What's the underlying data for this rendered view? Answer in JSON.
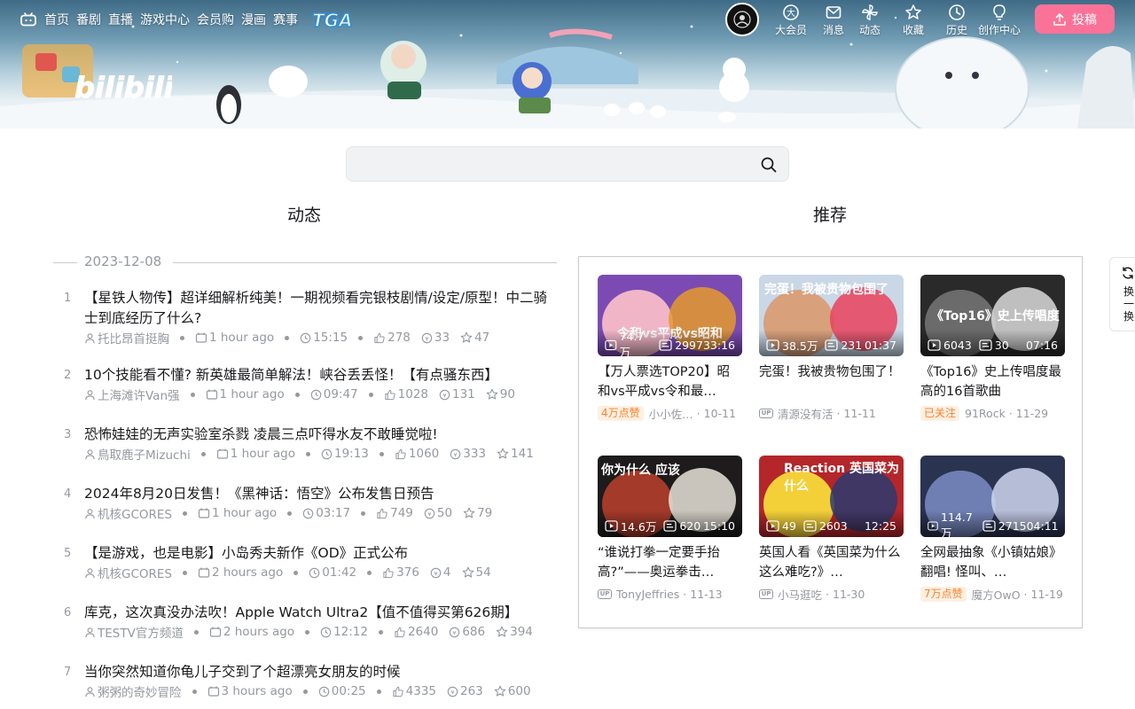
{
  "nav": {
    "left": [
      "首页",
      "番剧",
      "直播",
      "游戏中心",
      "会员购",
      "漫画",
      "赛事"
    ],
    "event_logo": "TGA",
    "right": [
      {
        "label": "大会员",
        "icon": "vip-icon"
      },
      {
        "label": "消息",
        "icon": "message-icon"
      },
      {
        "label": "动态",
        "icon": "dynamic-icon"
      },
      {
        "label": "收藏",
        "icon": "favorite-star-icon"
      },
      {
        "label": "历史",
        "icon": "history-clock-icon"
      },
      {
        "label": "创作中心",
        "icon": "creator-bulb-icon"
      }
    ],
    "upload": "投稿"
  },
  "brand": {
    "logo_text": "bilibili"
  },
  "search": {
    "placeholder": "",
    "value": ""
  },
  "sections": {
    "feed": "动态",
    "recommend": "推荐"
  },
  "feed": {
    "date": "2023-12-08",
    "items": [
      {
        "num": "1",
        "title": "【星铁人物传】超详细解析纯美！一期视频看完银枝剧情/设定/原型！中二骑士到底经历了什么?",
        "author": "托比昂首挺胸",
        "time": "1 hour ago",
        "duration": "15:15",
        "likes": "278",
        "coins": "33",
        "favs": "47"
      },
      {
        "num": "2",
        "title": "10个技能看不懂? 新英雄最简单解法！峡谷丢丢怪！【有点骚东西】",
        "author": "上海滩许Van强",
        "time": "1 hour ago",
        "duration": "09:47",
        "likes": "1028",
        "coins": "131",
        "favs": "90"
      },
      {
        "num": "3",
        "title": "恐怖娃娃的无声实验室杀戮 凌晨三点吓得水友不敢睡觉啦!",
        "author": "鳥取鹿子Mizuchi",
        "time": "1 hour ago",
        "duration": "19:13",
        "likes": "1060",
        "coins": "333",
        "favs": "141"
      },
      {
        "num": "4",
        "title": "2024年8月20日发售！《黑神话：悟空》公布发售日预告",
        "author": "机核GCORES",
        "time": "1 hour ago",
        "duration": "03:17",
        "likes": "749",
        "coins": "50",
        "favs": "79"
      },
      {
        "num": "5",
        "title": "【是游戏，也是电影】小岛秀夫新作《OD》正式公布",
        "author": "机核GCORES",
        "time": "2 hours ago",
        "duration": "01:42",
        "likes": "376",
        "coins": "4",
        "favs": "54"
      },
      {
        "num": "6",
        "title": "库克，这次真没办法吹！Apple Watch Ultra2【值不值得买第626期】",
        "author": "TESTV官方频道",
        "time": "2 hours ago",
        "duration": "12:12",
        "likes": "2640",
        "coins": "686",
        "favs": "394"
      },
      {
        "num": "7",
        "title": "当你突然知道你龟儿子交到了个超漂亮女朋友的时候",
        "author": "粥粥的奇妙冒险",
        "time": "3 hours ago",
        "duration": "00:25",
        "likes": "4335",
        "coins": "263",
        "favs": "600"
      }
    ]
  },
  "recommend": {
    "cards": [
      {
        "title": "【万人票选TOP20】昭和vs平成vs令和最…",
        "views": "74.7万",
        "danmaku": "2997",
        "duration": "33:16",
        "badge": "4万点赞",
        "up_icon": "",
        "author": "小小佐…",
        "date": "10-11",
        "caption": "令和vs平成vs昭和",
        "colors": [
          "#7b4bb3",
          "#f0b6c8",
          "#e59a2d"
        ]
      },
      {
        "title": "完蛋！我被贵物包围了！",
        "views": "38.5万",
        "danmaku": "231",
        "duration": "01:37",
        "badge": "",
        "up_icon": "UP",
        "author": "清源没有活",
        "date": "11-11",
        "caption": "完蛋！我被贵物包围了",
        "colors": [
          "#c9d7e6",
          "#d8a07b",
          "#e9425c"
        ]
      },
      {
        "title": "《Top16》史上传唱度最高的16首歌曲",
        "views": "6043",
        "danmaku": "30",
        "duration": "07:16",
        "badge": "已关注",
        "up_icon": "",
        "author": "91Rock",
        "date": "11-29",
        "caption": "《Top16》史上传唱度",
        "colors": [
          "#2a2a2a",
          "#6b6b6b",
          "#d9d9d9"
        ]
      },
      {
        "title": "“谁说打拳一定要手抬高?”——奥运拳击…",
        "views": "14.6万",
        "danmaku": "620",
        "duration": "15:10",
        "badge": "",
        "up_icon": "UP",
        "author": "TonyJeffries",
        "date": "11-13",
        "caption": "你为什么 应该",
        "colors": [
          "#1d1b1b",
          "#a33a2a",
          "#e8e3d9"
        ]
      },
      {
        "title": "英国人看《英国菜为什么这么难吃?》…",
        "views": "49",
        "danmaku": "2603",
        "duration": "12:25",
        "badge": "",
        "up_icon": "UP",
        "author": "小马逛吃",
        "date": "11-30",
        "caption": "Reaction 英国菜为什么",
        "colors": [
          "#b4262a",
          "#f3d038",
          "#2b3b6e"
        ]
      },
      {
        "title": "全网最抽象《小镇姑娘》翻唱! 怪叫、…",
        "views": "114.7万",
        "danmaku": "2715",
        "duration": "04:11",
        "badge": "7万点赞",
        "up_icon": "",
        "author": "魔方OwO",
        "date": "11-19",
        "caption": "",
        "colors": [
          "#2a3350",
          "#6f7fb3",
          "#cfd6ef"
        ]
      }
    ]
  },
  "side": {
    "refresh": "换一换"
  }
}
